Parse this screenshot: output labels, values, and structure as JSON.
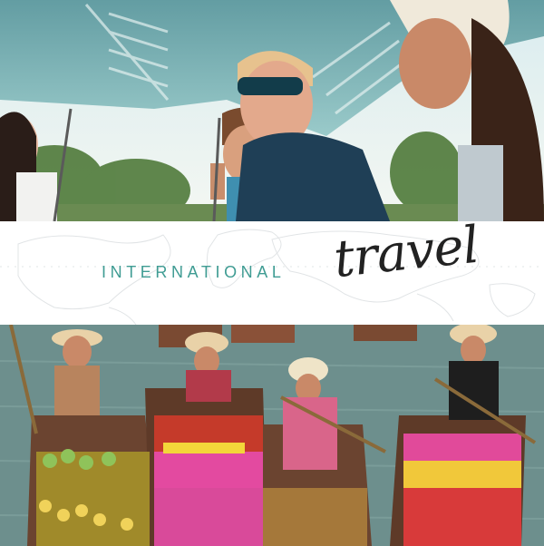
{
  "banner": {
    "word_international": "INTERNATIONAL",
    "word_travel": "travel"
  },
  "colors": {
    "accent_teal": "#3f9c93",
    "script_black": "#222222",
    "banner_bg": "#ffffff"
  }
}
